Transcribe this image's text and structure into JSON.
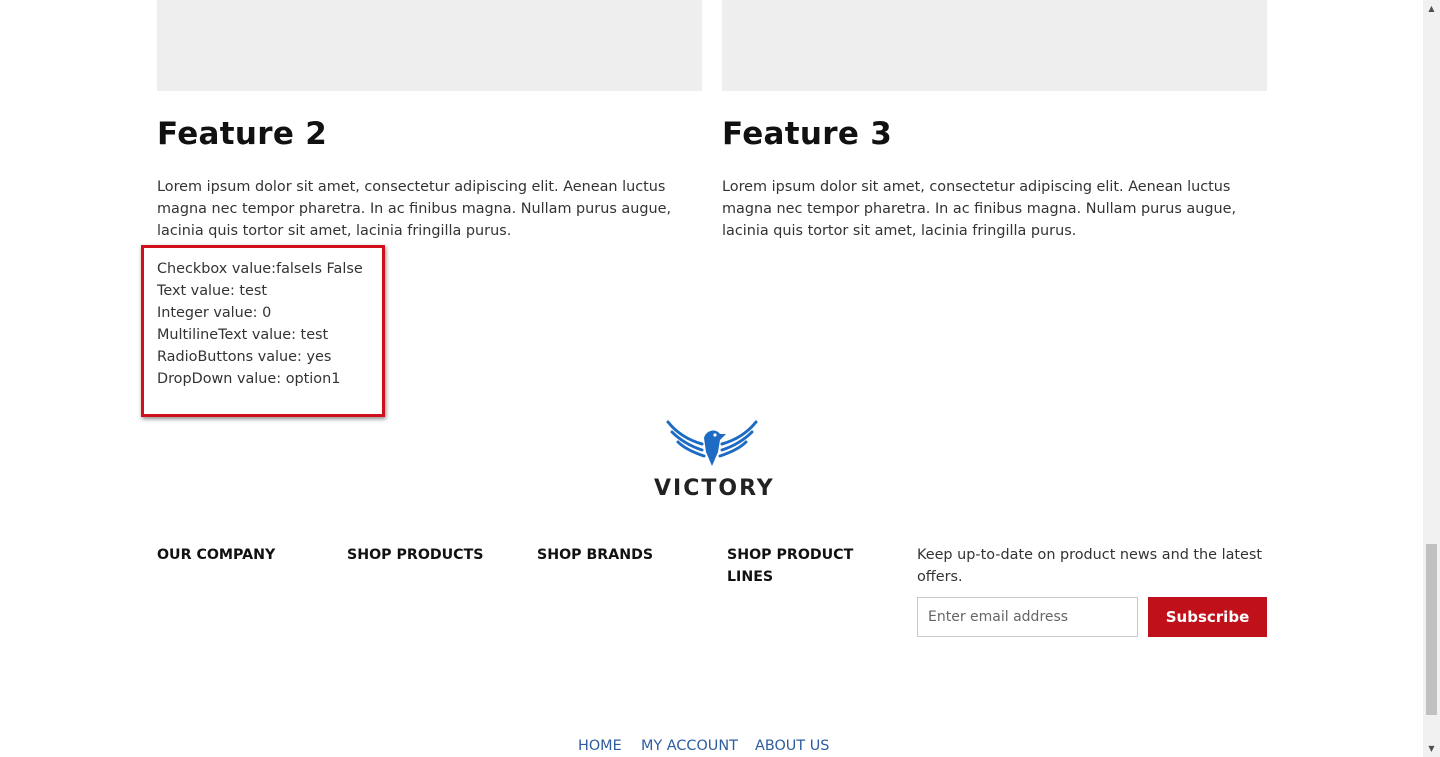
{
  "features": [
    {
      "title": "Feature 2",
      "text": "Lorem ipsum dolor sit amet, consectetur adipiscing elit. Aenean luctus magna nec tempor pharetra. In ac finibus magna. Nullam purus augue, lacinia quis tortor sit amet, lacinia fringilla purus."
    },
    {
      "title": "Feature 3",
      "text": "Lorem ipsum dolor sit amet, consectetur adipiscing elit. Aenean luctus magna nec tempor pharetra. In ac finibus magna. Nullam purus augue, lacinia quis tortor sit amet, lacinia fringilla purus."
    }
  ],
  "values": [
    "Checkbox value:falseIs False",
    "Text value: test",
    "Integer value: 0",
    "MultilineText value: test",
    "RadioButtons value: yes",
    "DropDown value: option1"
  ],
  "logo": {
    "word": "VICTORY",
    "icon": "eagle-wings-logo",
    "color": "#1e6bc4"
  },
  "footer": {
    "columns": [
      "OUR COMPANY",
      "SHOP PRODUCTS",
      "SHOP BRANDS",
      "SHOP PRODUCT LINES"
    ],
    "newsletter_text": "Keep up-to-date on product news and the latest offers.",
    "email_placeholder": "Enter email address",
    "subscribe_label": "Subscribe"
  },
  "bottom_nav": [
    "HOME",
    "MY ACCOUNT",
    "ABOUT US"
  ],
  "colors": {
    "accent": "#c0101a",
    "link": "#2e5c9e",
    "highlight": "#d0101c"
  }
}
